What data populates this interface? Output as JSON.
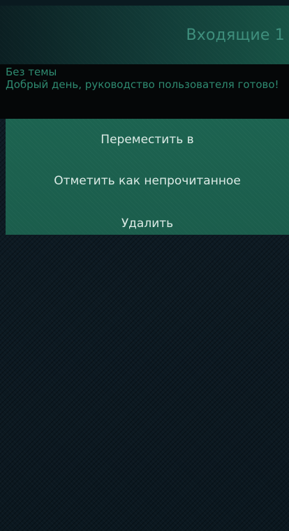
{
  "header": {
    "title": "Входящие 1"
  },
  "email": {
    "subject": "Без темы",
    "snippet": "Добрый день, руководство пользователя готово!"
  },
  "context_menu": {
    "items": [
      {
        "label": "Переместить в"
      },
      {
        "label": "Отметить как непрочитанное"
      },
      {
        "label": "Удалить"
      }
    ]
  },
  "colors": {
    "accent": "#1b5d4c",
    "text_accent": "#2e8a70",
    "background": "#0d1a22"
  }
}
